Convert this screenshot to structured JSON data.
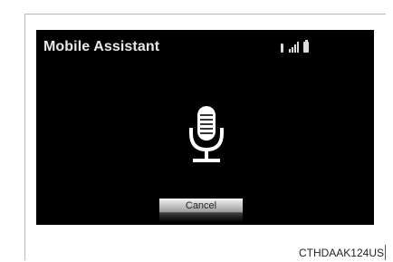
{
  "screen": {
    "title": "Mobile Assistant",
    "status_icons": [
      "bluetooth-icon",
      "signal-icon",
      "battery-icon"
    ],
    "cancel_label": "Cancel"
  },
  "caption": "CTHDAAK124US",
  "colors": {
    "screen_background": "#000000",
    "title_text": "#e8e8e8",
    "button_gradient_top": "#eeeeee",
    "button_gradient_bottom": "#9a9a9a"
  }
}
